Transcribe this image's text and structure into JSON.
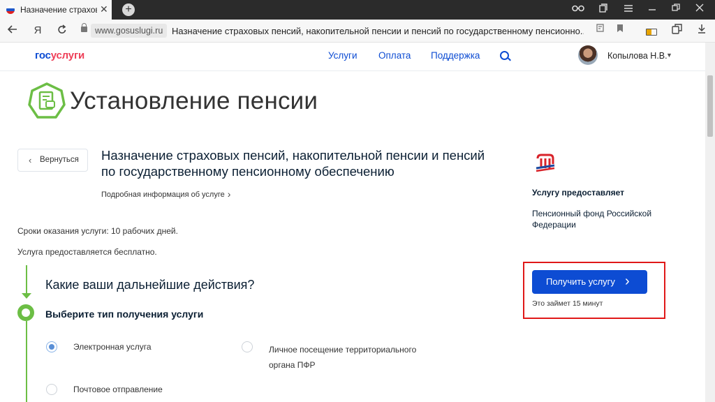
{
  "browser": {
    "tab_title": "Назначение страховых",
    "tab_close": "✕",
    "new_tab": "+",
    "domain": "www.gosuslugi.ru",
    "page_title": "Назначение страховых пенсий, накопительной пенсии и пенсий по государственному пенсионно...",
    "yandex_button": "Я"
  },
  "header": {
    "logo_part1": "гос",
    "logo_part2": "услуги",
    "nav": [
      "Услуги",
      "Оплата",
      "Поддержка"
    ],
    "username": "Копылова Н.В.",
    "caret": "▼"
  },
  "hero": {
    "title": "Установление пенсии"
  },
  "service": {
    "back_label": "Вернуться",
    "title": "Назначение страховых пенсий, накопительной пенсии и пенсий по государственному пенсионному обеспечению",
    "more_info": "Подробная информация об услуге",
    "term": "Сроки оказания услуги: 10 рабочих дней.",
    "free": "Услуга предоставляется бесплатно."
  },
  "provider": {
    "label": "Услугу предоставляет",
    "name": "Пенсионный фонд Российской Федерации",
    "button": "Получить услугу",
    "duration": "Это займет 15 минут"
  },
  "steps": {
    "question": "Какие ваши дальнейшие действия?",
    "title": "Выберите тип получения услуги",
    "options": [
      "Электронная услуга",
      "Личное посещение территориального органа ПФР",
      "Почтовое отправление"
    ],
    "selected": "Электронная услуга"
  },
  "colors": {
    "accent": "#0d4cd3",
    "logo_red": "#ee3f58",
    "step_green": "#6cbe45",
    "highlight": "#e01818"
  }
}
